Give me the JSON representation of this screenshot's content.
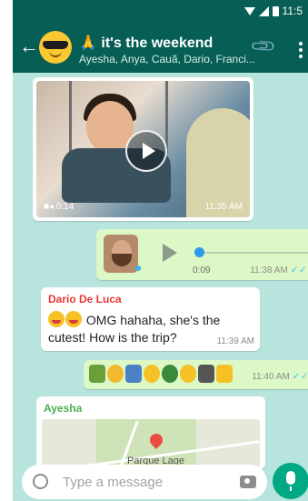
{
  "status_bar": {
    "time": "11:5"
  },
  "header": {
    "title": "🙏 it's the weekend",
    "participants": "Ayesha, Anya, Cauã, Dario, Franci..."
  },
  "messages": {
    "video": {
      "duration": "0:14",
      "time": "11:35 AM"
    },
    "voice": {
      "duration": "0:09",
      "time": "11:38 AM",
      "read_ticks": "✓✓"
    },
    "dario": {
      "sender": "Dario De Luca",
      "text": "OMG hahaha, she's the cutest! How is the trip?",
      "time": "11:39 AM"
    },
    "emoji_message": {
      "time": "11:40 AM",
      "read_ticks": "✓✓"
    },
    "ayesha": {
      "sender": "Ayesha",
      "place": "Parque Lage"
    }
  },
  "composer": {
    "placeholder": "Type a message"
  },
  "colors": {
    "header": "#075e54",
    "outgoing": "#dcf8c6",
    "accent": "#00a884",
    "dario_name": "#e53935",
    "ayesha_name": "#4caf50"
  }
}
